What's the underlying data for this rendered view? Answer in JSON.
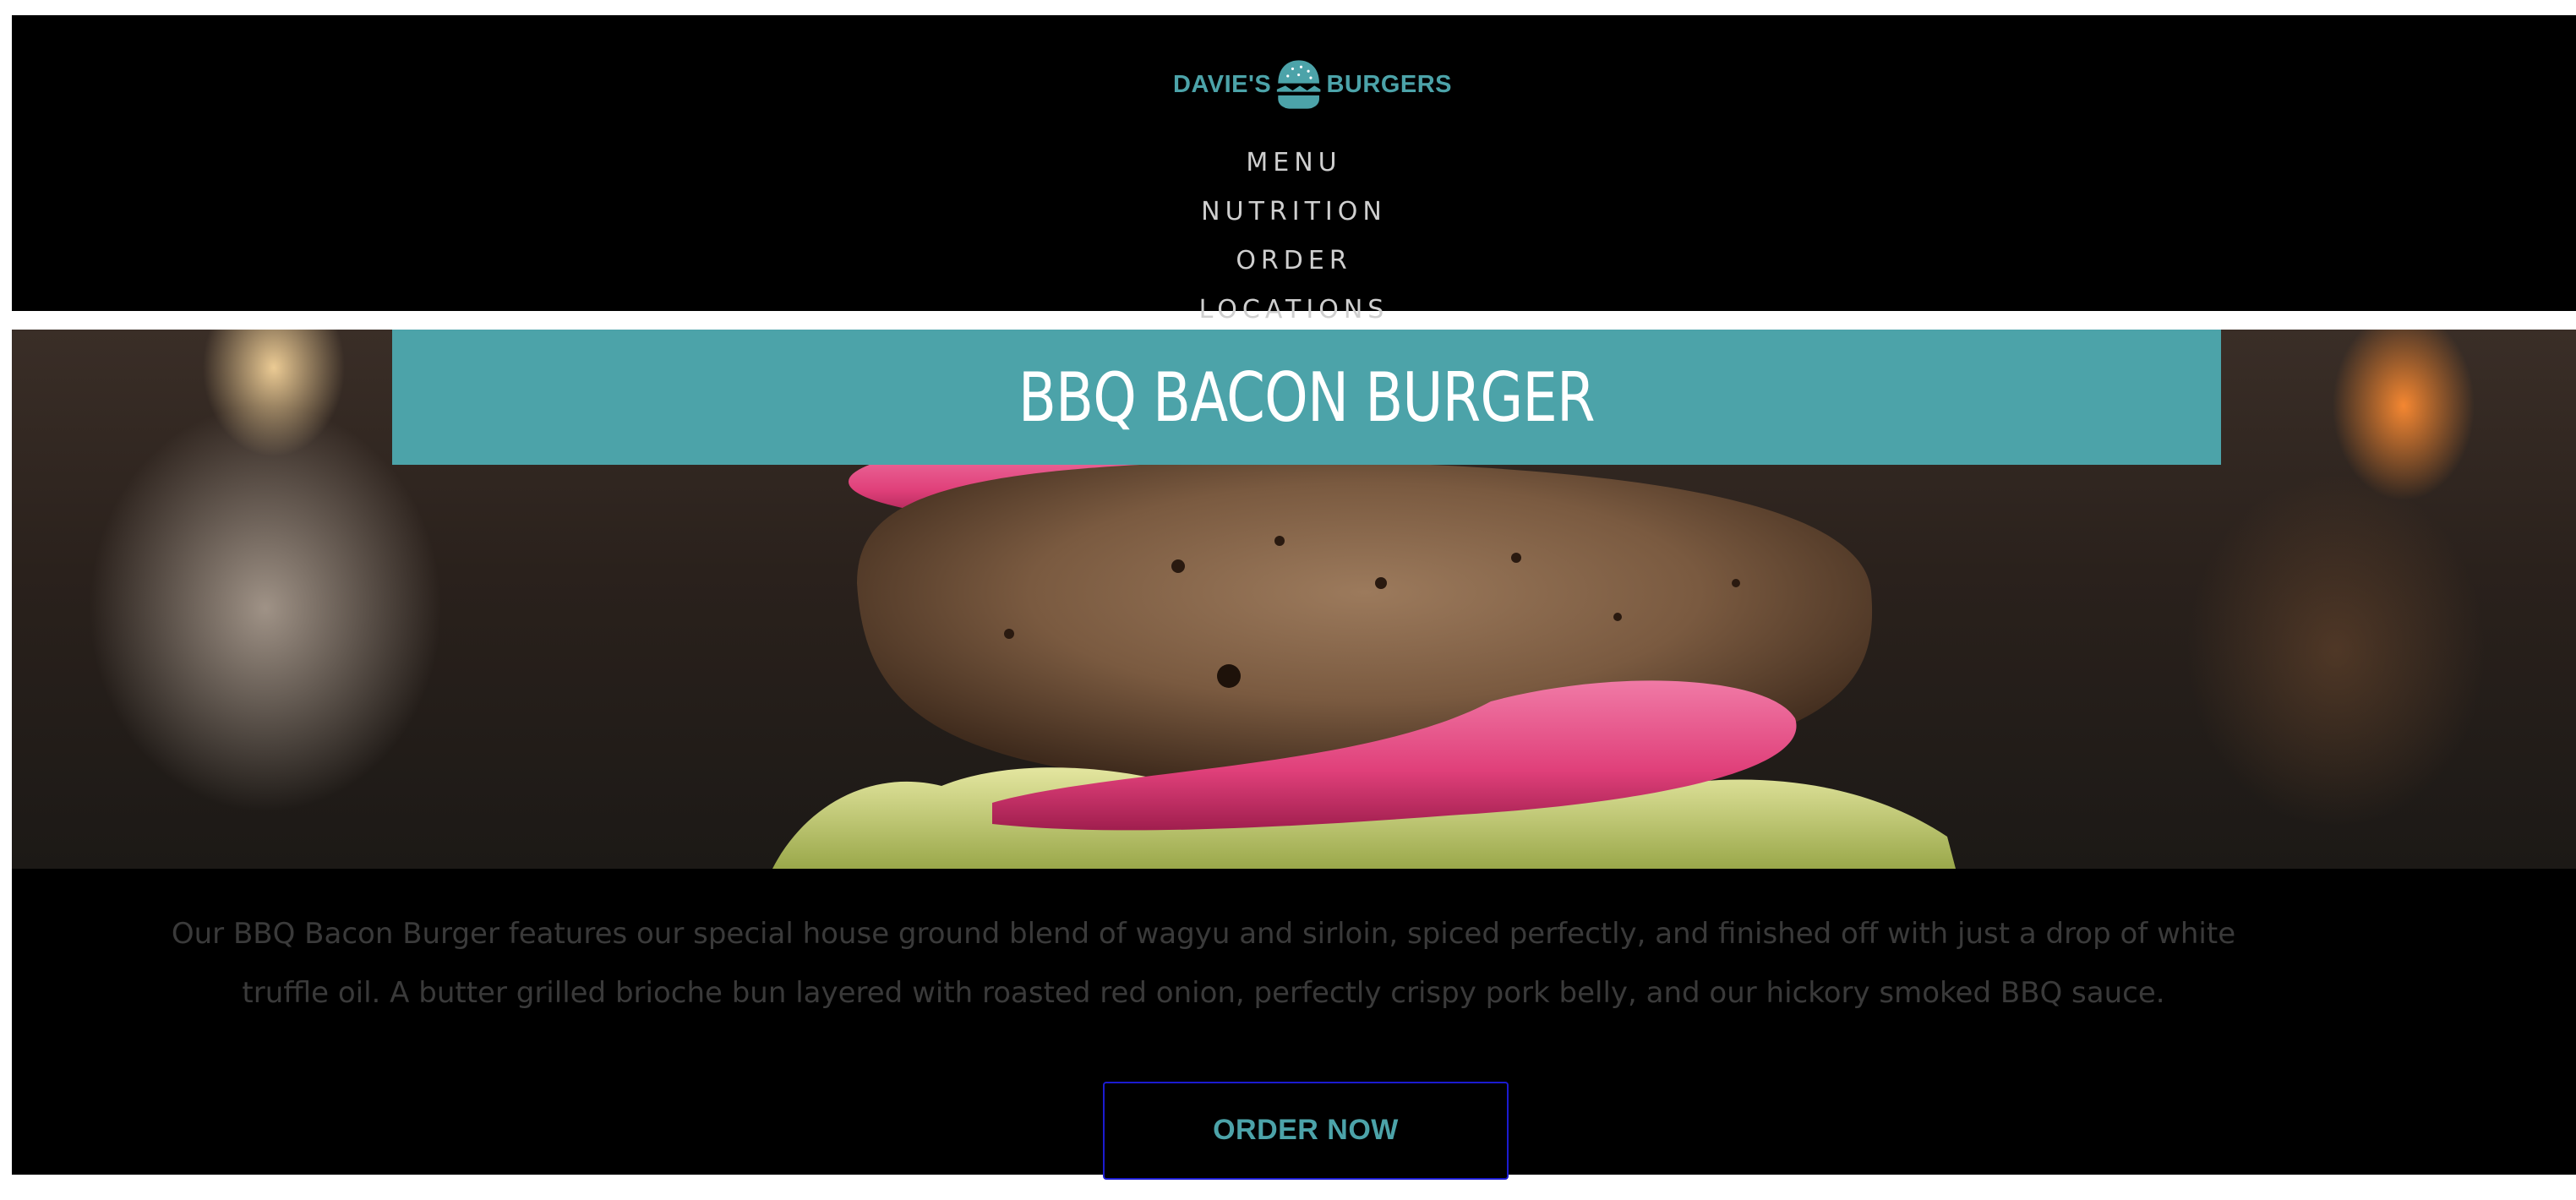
{
  "brand": {
    "left_word": "DAVIE'S",
    "right_word": "BURGERS",
    "accent_color": "#4ca3a9"
  },
  "nav": {
    "items": [
      {
        "label": "MENU"
      },
      {
        "label": "NUTRITION"
      },
      {
        "label": "ORDER"
      },
      {
        "label": "LOCATIONS"
      }
    ]
  },
  "hero": {
    "title": "BBQ BACON BURGER",
    "image_subject": "burger-photo"
  },
  "content": {
    "description": "Our BBQ Bacon Burger features our special house ground blend of wagyu and sirloin, spiced perfectly, and finished off with just a drop of white truffle oil. A butter grilled brioche bun layered with roasted red onion, perfectly crispy pork belly, and our hickory smoked BBQ sauce.",
    "cta_label": "ORDER NOW"
  },
  "colors": {
    "header_bg": "#000000",
    "banner_bg": "#4ca3a9",
    "button_border": "#1b1bd0"
  }
}
